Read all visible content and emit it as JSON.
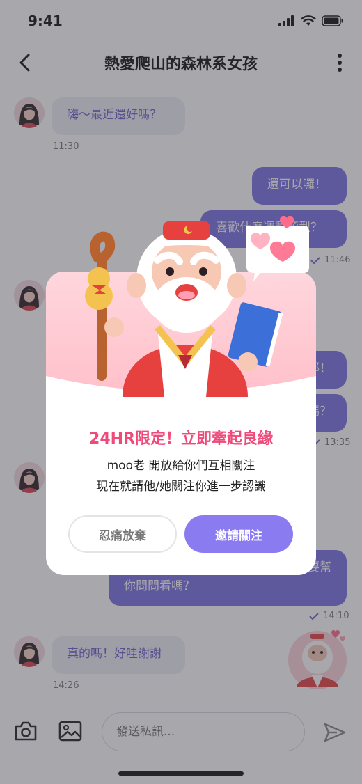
{
  "status_bar": {
    "time": "9:41"
  },
  "header": {
    "title": "熱愛爬山的森林系女孩"
  },
  "messages": [
    {
      "direction": "in",
      "text": "嗨～最近還好嗎？",
      "time": "11:30"
    },
    {
      "direction": "out",
      "text": "還可以囉！"
    },
    {
      "direction": "out",
      "text": "喜歡什麼運動類型？",
      "time": "11:46"
    },
    {
      "direction": "in",
      "text": "",
      "time": ""
    },
    {
      "direction": "out",
      "text": "耶！"
    },
    {
      "direction": "out",
      "text": "嗎？",
      "time": "13:35"
    },
    {
      "direction": "in",
      "text": ""
    },
    {
      "direction": "out",
      "text_line1": "要幫",
      "text_line2": "你問問看嗎？",
      "time": "14:10"
    },
    {
      "direction": "in",
      "text": "真的嗎！好哇謝謝",
      "time": "14:26"
    }
  ],
  "input_bar": {
    "placeholder": "發送私訊..."
  },
  "modal": {
    "headline": "24HR限定！立即牽起良緣",
    "body_line1": "moo老 開放給你們互相關注",
    "body_line2": "現在就請他/她關注你進一步認識",
    "decline_label": "忍痛放棄",
    "invite_label": "邀請關注"
  },
  "colors": {
    "accent": "#7b6fe4",
    "headline_pink": "#f04a7b",
    "invite_button": "#8a7cf0"
  },
  "icons": [
    "back-arrow-icon",
    "more-vertical-icon",
    "camera-icon",
    "image-icon",
    "send-icon",
    "read-check-icon",
    "signal-icon",
    "wifi-icon",
    "battery-icon"
  ]
}
